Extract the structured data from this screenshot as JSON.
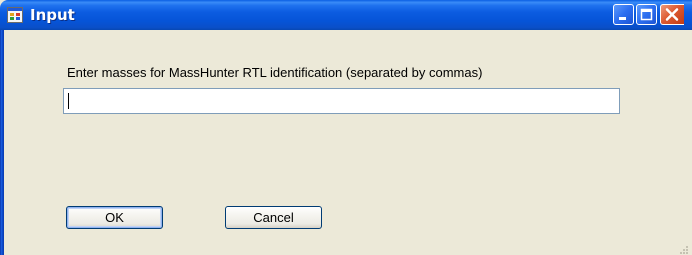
{
  "window": {
    "title": "Input",
    "app_icon": "form-icon",
    "controls": {
      "minimize": "minimize-icon",
      "maximize": "maximize-icon",
      "close": "close-icon"
    }
  },
  "dialog": {
    "prompt": "Enter masses for MassHunter RTL identification (separated by commas)",
    "input_value": "",
    "input_placeholder": "",
    "ok_label": "OK",
    "cancel_label": "Cancel"
  },
  "colors": {
    "titlebar": "#0a5fe3",
    "client_background": "#ece9d8",
    "input_border": "#7f9db9",
    "button_border": "#003c74",
    "close_button": "#dd5a32"
  }
}
